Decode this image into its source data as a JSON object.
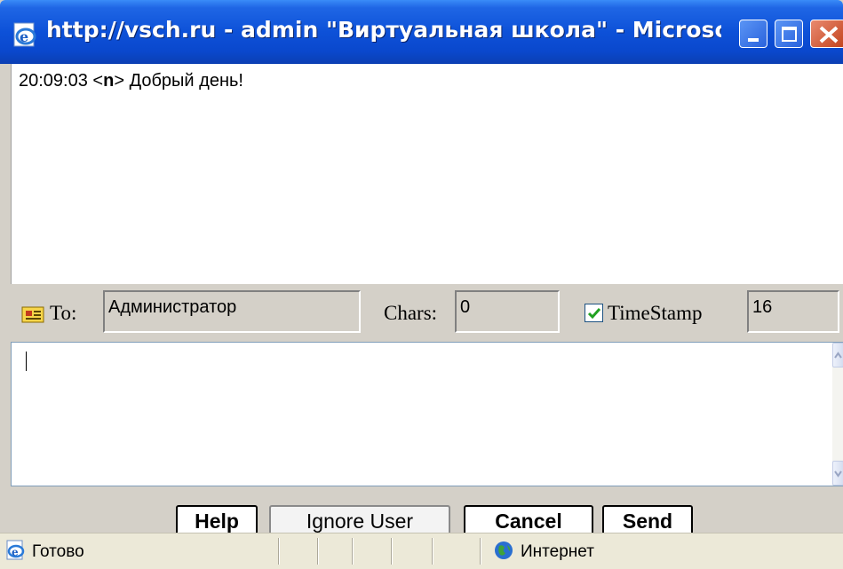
{
  "window": {
    "title": "http://vsch.ru - admin \"Виртуальная школа\" - Microsoft I..."
  },
  "chat": {
    "messages": [
      {
        "time": "20:09:03",
        "user": "n",
        "text": "Добрый день!"
      }
    ]
  },
  "controls": {
    "to_label": "To:",
    "to_value": "Администратор",
    "chars_label": "Chars:",
    "chars_value": "0",
    "timestamp_label": "TimeStamp",
    "timestamp_checked": true,
    "font_size_value": "16"
  },
  "input": {
    "value": ""
  },
  "buttons": {
    "help": "Help",
    "ignore": "Ignore User",
    "cancel": "Cancel",
    "send": "Send"
  },
  "status": {
    "text": "Готово",
    "zone": "Интернет"
  },
  "icons": {
    "window": "ie-page-icon",
    "to": "address-card-icon",
    "checkbox": "checkmark-icon",
    "status": "ie-page-icon",
    "zone": "globe-icon"
  }
}
